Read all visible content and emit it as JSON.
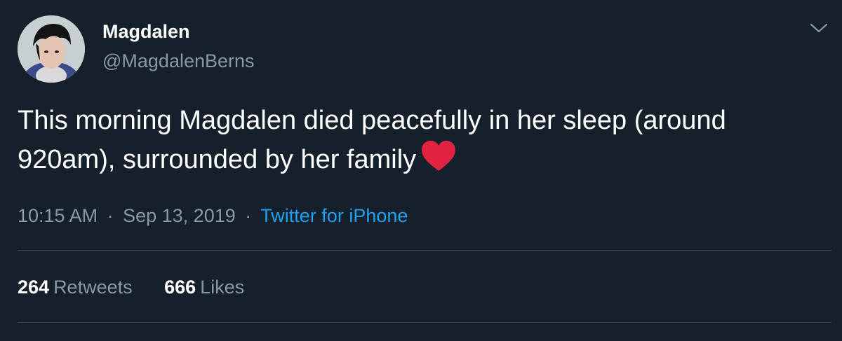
{
  "author": {
    "display_name": "Magdalen",
    "handle": "@MagdalenBerns"
  },
  "tweet": {
    "text": "This morning Magdalen died peacefully in her sleep (around 920am), surrounded by her family",
    "emoji": "red-heart"
  },
  "meta": {
    "time": "10:15 AM",
    "date": "Sep 13, 2019",
    "separator": "·",
    "source": "Twitter for iPhone"
  },
  "stats": {
    "retweets_count": "264",
    "retweets_label": "Retweets",
    "likes_count": "666",
    "likes_label": "Likes"
  },
  "icons": {
    "menu": "chevron-down-icon"
  },
  "colors": {
    "background": "#15202b",
    "text_primary": "#ffffff",
    "text_secondary": "#8899a6",
    "link": "#1da1f2",
    "divider": "#38444d",
    "heart": "#e0243f"
  }
}
